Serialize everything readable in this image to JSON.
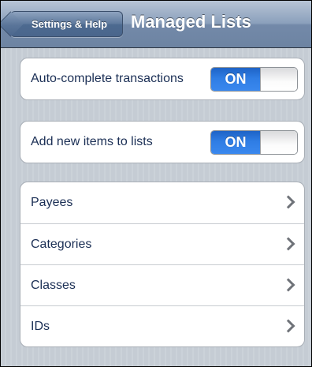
{
  "navbar": {
    "back_label": "Settings & Help",
    "title": "Managed Lists"
  },
  "toggles": [
    {
      "label": "Auto-complete transactions",
      "state": "ON"
    },
    {
      "label": "Add new items to lists",
      "state": "ON"
    }
  ],
  "lists": [
    {
      "label": "Payees"
    },
    {
      "label": "Categories"
    },
    {
      "label": "Classes"
    },
    {
      "label": "IDs"
    }
  ],
  "colors": {
    "switch_on": "#2f7de4",
    "nav_bar": "#8ba0bc",
    "row_text": "#1b2f55"
  }
}
